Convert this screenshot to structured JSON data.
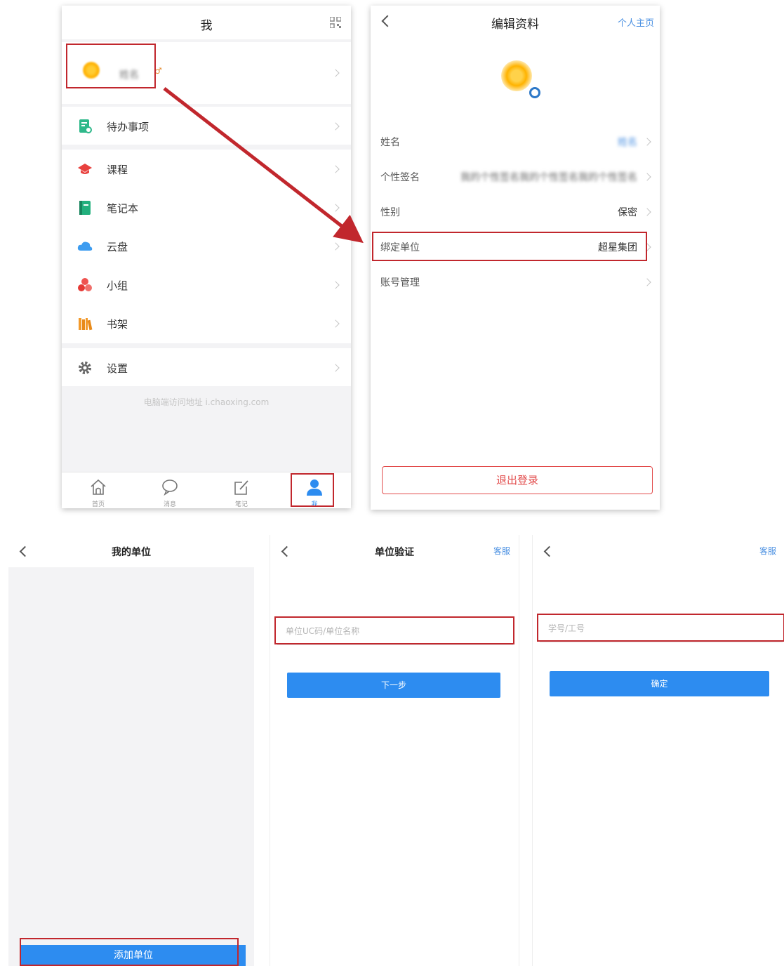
{
  "screen_me": {
    "title": "我",
    "profile_name": "姓名",
    "gender_mark": "♂",
    "menu": [
      {
        "label": "待办事项",
        "icon": "todo-icon"
      },
      {
        "label": "课程",
        "icon": "course-icon"
      },
      {
        "label": "笔记本",
        "icon": "notebook-icon"
      },
      {
        "label": "云盘",
        "icon": "cloud-icon"
      },
      {
        "label": "小组",
        "icon": "group-icon"
      },
      {
        "label": "书架",
        "icon": "bookshelf-icon"
      },
      {
        "label": "设置",
        "icon": "gear-icon"
      }
    ],
    "footer_note": "电脑端访问地址 i.chaoxing.com",
    "tabs": [
      {
        "label": "首页",
        "icon": "home-icon"
      },
      {
        "label": "消息",
        "icon": "message-icon"
      },
      {
        "label": "笔记",
        "icon": "note-icon"
      },
      {
        "label": "我",
        "icon": "user-icon"
      }
    ]
  },
  "screen_edit_profile": {
    "title": "编辑资料",
    "home_link": "个人主页",
    "fields": [
      {
        "label": "姓名",
        "value": "姓名"
      },
      {
        "label": "个性签名",
        "value": "我的个性签名我的个性签名我的个性签名"
      },
      {
        "label": "性别",
        "value": "保密"
      },
      {
        "label": "绑定单位",
        "value": "超星集团"
      },
      {
        "label": "账号管理",
        "value": ""
      }
    ],
    "logout_label": "退出登录"
  },
  "screen_my_units": {
    "title": "我的单位",
    "add_unit_label": "添加单位"
  },
  "screen_unit_verify": {
    "title": "单位验证",
    "service": "客服",
    "input_placeholder": "单位UC码/单位名称",
    "next_label": "下一步"
  },
  "screen_id_verify": {
    "service": "客服",
    "input_placeholder": "学号/工号",
    "confirm_label": "确定"
  },
  "colors": {
    "accent_blue": "#2d8cf0",
    "highlight_red": "#c1272d",
    "logout_red": "#e24b4b"
  }
}
